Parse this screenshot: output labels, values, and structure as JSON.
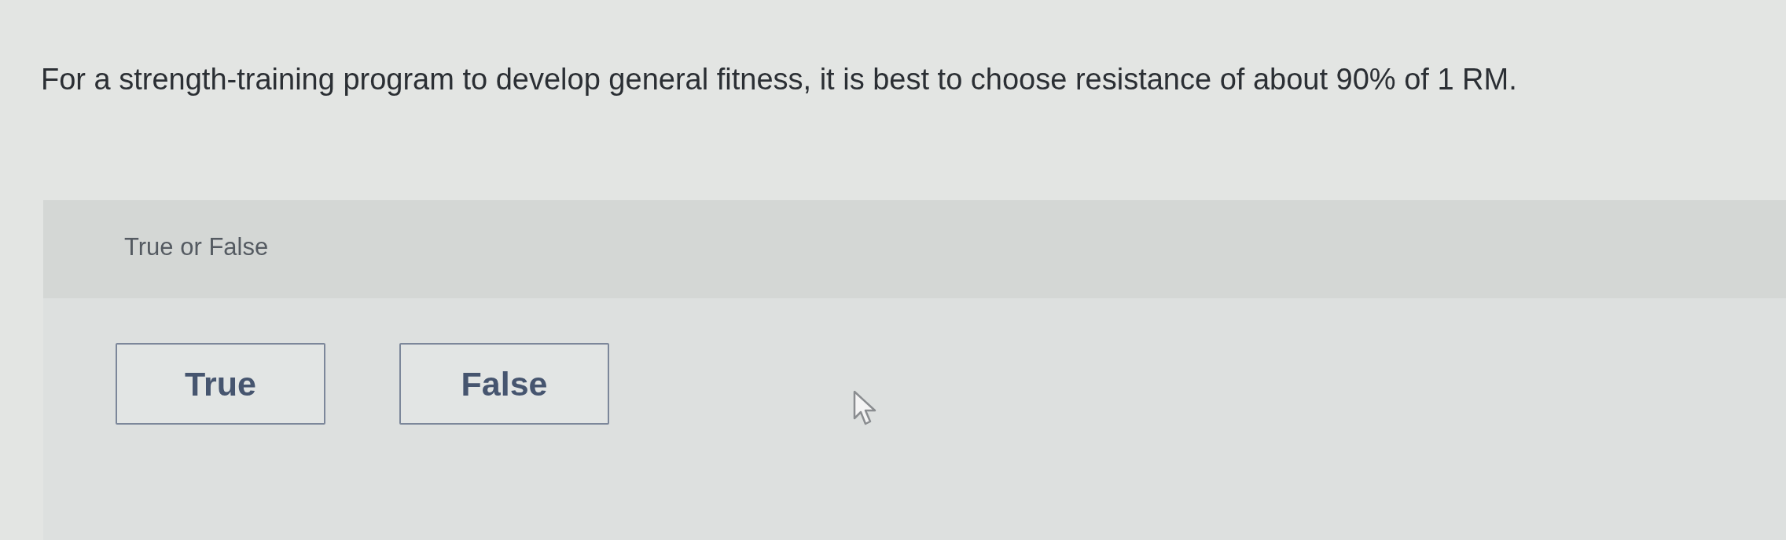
{
  "question": {
    "text": "For a strength-training program to develop general fitness, it is best to choose resistance of about 90% of 1 RM."
  },
  "answer_panel": {
    "instruction": "True or False",
    "options": [
      {
        "label": "True"
      },
      {
        "label": "False"
      }
    ]
  }
}
